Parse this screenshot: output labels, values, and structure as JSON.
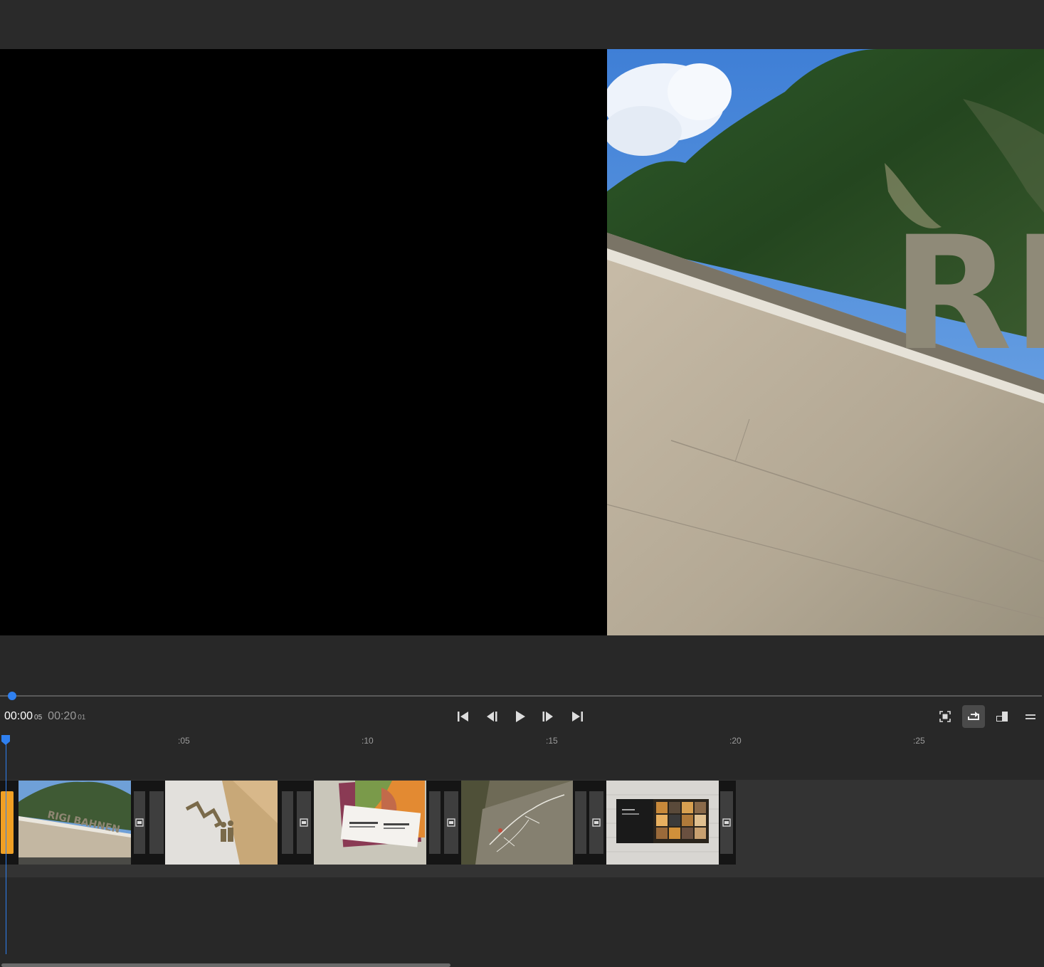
{
  "player": {
    "current_time": "00:00",
    "current_frames": "05",
    "duration": "00:20",
    "duration_frames": "01",
    "playhead_progress": 0.0
  },
  "transport": {
    "go_to_start": "skip-back-icon",
    "prev_frame": "step-back-icon",
    "play": "play-icon",
    "next_frame": "step-forward-icon",
    "go_to_end": "skip-forward-icon"
  },
  "view_controls": [
    "fit-icon",
    "loop-icon",
    "picture-in-picture-icon",
    "menu-icon"
  ],
  "ruler": {
    "ticks": [
      ":05",
      ":10",
      ":15",
      ":20",
      ":25"
    ]
  },
  "clips": [
    {
      "name": "rigi-bahnen-clip",
      "sign_text": "RIGI BAHNEN"
    },
    {
      "name": "signage-clip"
    },
    {
      "name": "brochures-clip"
    },
    {
      "name": "map-clip"
    },
    {
      "name": "exhibition-clip"
    }
  ],
  "preview": {
    "sign_text": "RIG"
  },
  "colors": {
    "accent": "#2f80f0",
    "selected_clip": "#f0a024",
    "background": "#282828"
  }
}
